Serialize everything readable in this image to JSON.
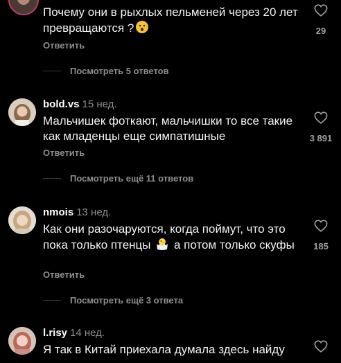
{
  "comments": [
    {
      "user": "",
      "time": "",
      "text_before_emoji": "Почему они в рыхлых пельменей через 20 лет превращаются ?",
      "text_after_emoji": "",
      "emoji": "hushed-face",
      "reply_label": "Ответить",
      "view_replies_label": "Посмотреть 5 ответов",
      "likes": "29"
    },
    {
      "user": "bold.vs",
      "time": "15 нед.",
      "text_before_emoji": "Мальчишек фоткают, мальчишки то все такие как младенцы еще симпатишные",
      "text_after_emoji": "",
      "emoji": "",
      "reply_label": "Ответить",
      "view_replies_label": "Посмотреть ещё 11 ответов",
      "likes": "3 891"
    },
    {
      "user": "nmois",
      "time": "13 нед.",
      "text_before_emoji": "Как они разочаруются, когда поймут, что это пока только птенцы",
      "text_after_emoji": "а потом только скуфы",
      "emoji": "hatching-chick",
      "reply_label": "Ответить",
      "view_replies_label": "Посмотреть ещё 3 ответа",
      "likes": "185"
    },
    {
      "user": "l.risy",
      "time": "14 нед.",
      "text_before_emoji": "Я так в Китай приехала думала здесь найду",
      "text_after_emoji": "",
      "emoji": "",
      "reply_label": "",
      "view_replies_label": "",
      "likes": ""
    }
  ],
  "colors": {
    "background": "#000000",
    "secondary_text": "#8e8e93",
    "icon": "#a0a0a4"
  },
  "icons": [
    "heart-outline-icon",
    "hushed-face-emoji",
    "hatching-chick-emoji"
  ]
}
